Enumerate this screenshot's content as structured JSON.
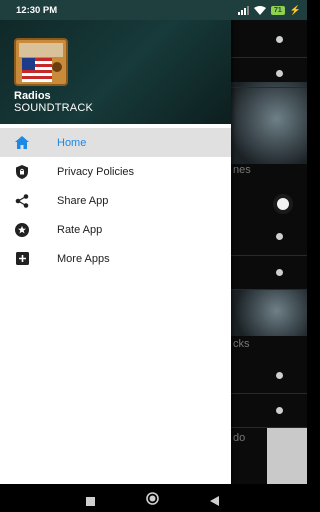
{
  "status_bar": {
    "time": "12:30 PM",
    "battery": "71",
    "icons": [
      "signal-icon",
      "wifi-icon",
      "battery-icon",
      "charging-icon"
    ]
  },
  "drawer": {
    "header": {
      "title": "Radios",
      "subtitle": "SOUNDTRACK"
    },
    "items": [
      {
        "label": "Home",
        "icon": "home-icon",
        "active": true
      },
      {
        "label": "Privacy Policies",
        "icon": "shield-icon",
        "active": false
      },
      {
        "label": "Share App",
        "icon": "share-icon",
        "active": false
      },
      {
        "label": "Rate App",
        "icon": "star-icon",
        "active": false
      },
      {
        "label": "More Apps",
        "icon": "plus-box-icon",
        "active": false
      }
    ]
  },
  "background": {
    "text_1": "nes",
    "text_2": "cks",
    "text_3": "do"
  },
  "colors": {
    "accent": "#1e88e5",
    "header_bg": "#173a3a",
    "active_bg": "#e0e0e0"
  },
  "nav_bar": {
    "buttons": [
      "recents-button",
      "home-button",
      "back-button"
    ]
  }
}
